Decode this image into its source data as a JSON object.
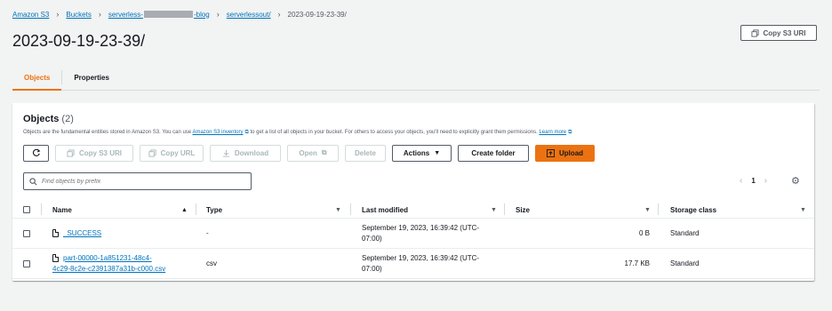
{
  "breadcrumb": {
    "s3": "Amazon S3",
    "buckets": "Buckets",
    "bucket_prefix": "serverless-",
    "bucket_suffix": "-blog",
    "folder": "serverlessout/",
    "current": "2023-09-19-23-39/"
  },
  "page_title": "2023-09-19-23-39/",
  "copy_uri_top_label": "Copy S3 URI",
  "tabs": [
    {
      "label": "Objects",
      "active": true
    },
    {
      "label": "Properties",
      "active": false
    }
  ],
  "objects_panel": {
    "title": "Objects",
    "count": "(2)",
    "description_start": "Objects are the fundamental entities stored in Amazon S3. You can use",
    "inventory_link": "Amazon S3 inventory",
    "description_mid": "to get a list of all objects in your bucket. For others to access your objects, you'll need to explicitly grant them permissions.",
    "learn_more": "Learn more"
  },
  "actions": {
    "copy_s3_uri": "Copy S3 URI",
    "copy_url": "Copy URL",
    "download": "Download",
    "open": "Open",
    "delete": "Delete",
    "actions": "Actions",
    "create_folder": "Create folder",
    "upload": "Upload"
  },
  "search": {
    "placeholder": "Find objects by prefix"
  },
  "pagination": {
    "page": "1"
  },
  "columns": {
    "name": "Name",
    "type": "Type",
    "last_modified": "Last modified",
    "size": "Size",
    "storage_class": "Storage class"
  },
  "rows": [
    {
      "name": "_SUCCESS",
      "name_line2": "",
      "type": "-",
      "modified_line1": "September 19, 2023, 16:39:42 (UTC-",
      "modified_line2": "07:00)",
      "size": "0 B",
      "storage_class": "Standard"
    },
    {
      "name": "part-00000-1a851231-48c4-",
      "name_line2": "4c29-8c2e-c2391387a31b-c000.csv",
      "type": "csv",
      "modified_line1": "September 19, 2023, 16:39:42 (UTC-",
      "modified_line2": "07:00)",
      "size": "17.7 KB",
      "storage_class": "Standard"
    }
  ],
  "colors": {
    "accent_orange": "#ec7211",
    "link_blue": "#0073bb",
    "background": "#f2f3f3"
  }
}
